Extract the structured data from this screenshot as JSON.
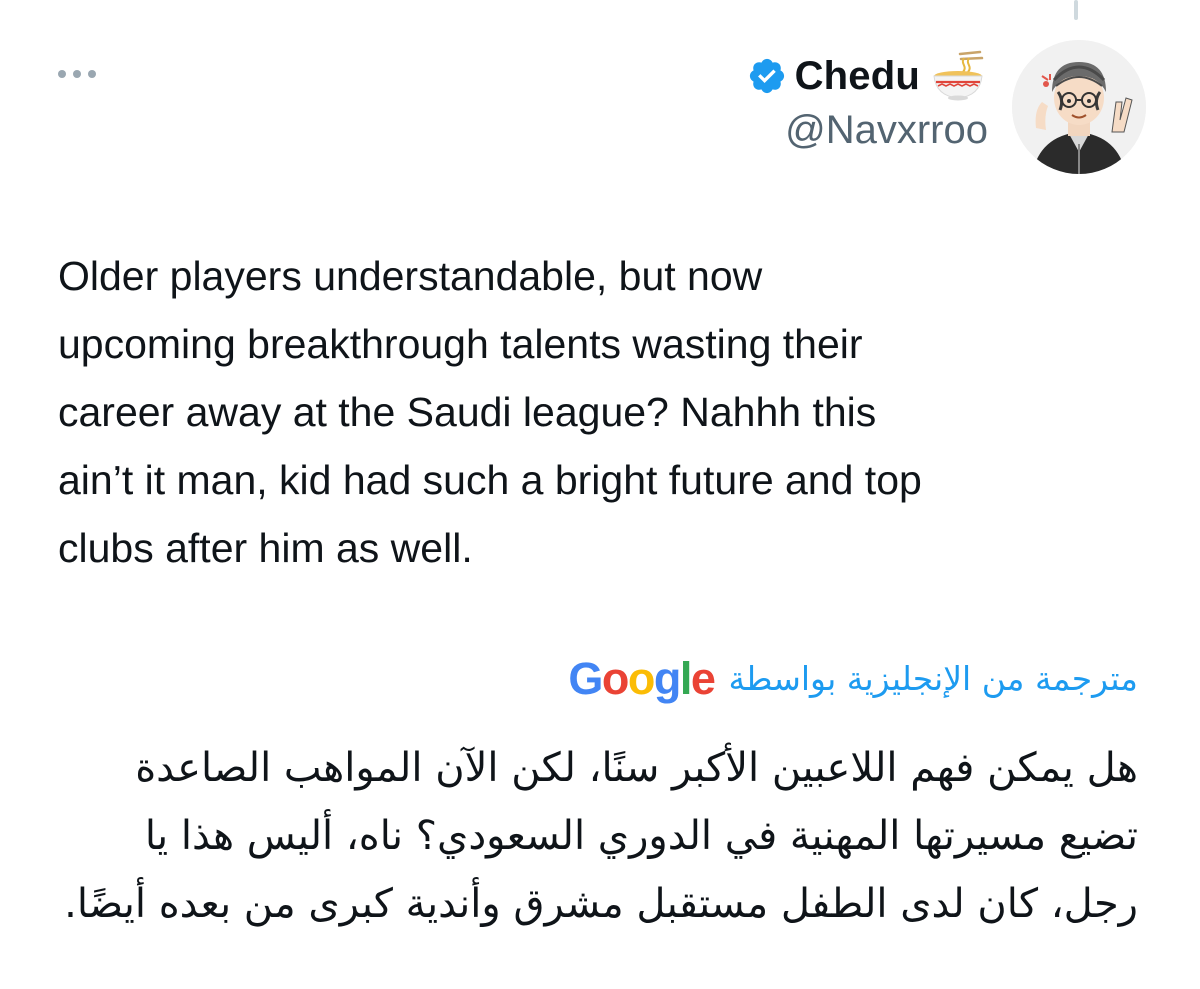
{
  "author": {
    "display_name": "Chedu",
    "handle": "@Navxrroo",
    "verified": true,
    "badge_color": "#1d9bf0",
    "name_emoji": "ramen-bowl-icon"
  },
  "tweet": {
    "lines": [
      "Older players understandable, but now",
      "upcoming breakthrough talents wasting their",
      "career away at the Saudi league? Nahhh this",
      "ain’t it man, kid had such a bright future and top",
      "clubs after him as well."
    ]
  },
  "translation": {
    "label": "مترجمة من الإنجليزية بواسطة",
    "provider": "Google",
    "provider_letters": [
      {
        "ch": "G",
        "color": "#4285f4"
      },
      {
        "ch": "o",
        "color": "#ea4335"
      },
      {
        "ch": "o",
        "color": "#fbbc05"
      },
      {
        "ch": "g",
        "color": "#4285f4"
      },
      {
        "ch": "l",
        "color": "#34a853"
      },
      {
        "ch": "e",
        "color": "#ea4335"
      }
    ],
    "lines": [
      "هل يمكن فهم اللاعبين الأكبر سنًا، لكن الآن المواهب الصاعدة",
      "تضيع مسيرتها المهنية في الدوري السعودي؟ ناه، أليس هذا يا",
      "رجل، كان لدى الطفل مستقبل مشرق وأندية كبرى من بعده أيضًا."
    ]
  },
  "colors": {
    "text_primary": "#0f1419",
    "text_secondary": "#536471",
    "link_blue": "#1d9bf0"
  }
}
